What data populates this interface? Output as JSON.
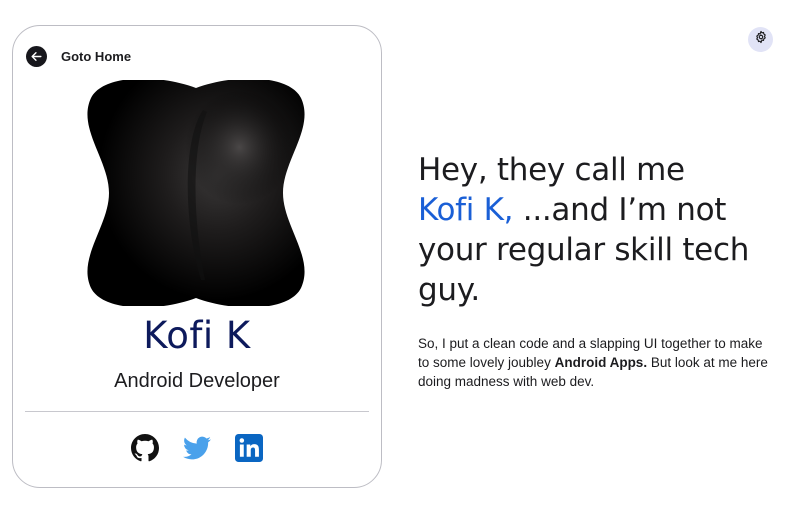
{
  "card": {
    "home_label": "Goto Home",
    "name": "Kofi K",
    "role": "Android Developer",
    "socials": [
      {
        "icon": "github-icon",
        "color": "#111111"
      },
      {
        "icon": "twitter-icon",
        "color": "#4aa1eb"
      },
      {
        "icon": "linkedin-icon",
        "color": "#0a66c2"
      }
    ]
  },
  "hero": {
    "line1": "Hey, they call me",
    "highlight": "Kofi K,",
    "line2_rest": " ...and I’m not",
    "line3": "your regular skill tech",
    "line4": "guy."
  },
  "intro": {
    "part1": "So, I put a clean code and a slapping UI together to make to some lovely joubley ",
    "bold": "Android Apps.",
    "part2": " But look at me here doing madness with web dev."
  },
  "colors": {
    "accent": "#1a5fd6",
    "name": "#0d1a5c",
    "settings_bg": "#e1e3f6"
  }
}
